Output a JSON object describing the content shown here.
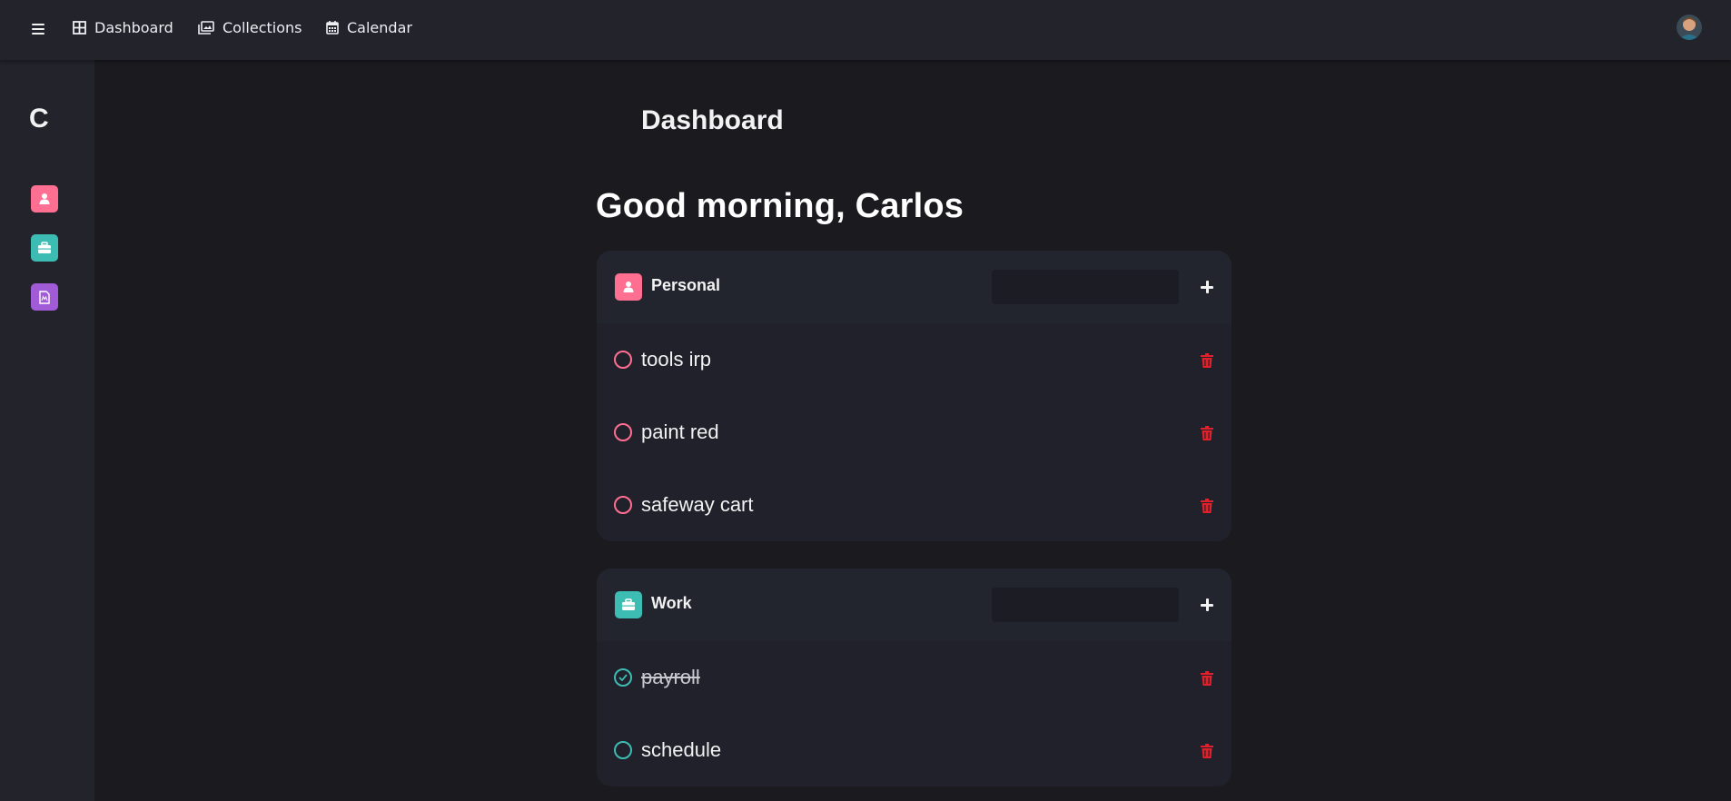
{
  "nav": {
    "items": [
      {
        "label": "Dashboard",
        "icon": "grid-icon"
      },
      {
        "label": "Collections",
        "icon": "images-icon"
      },
      {
        "label": "Calendar",
        "icon": "calendar-icon"
      }
    ]
  },
  "sidebar": {
    "brand": "C",
    "items": [
      {
        "icon": "user-icon",
        "color": "#ff6f91"
      },
      {
        "icon": "briefcase-icon",
        "color": "#3dbcb4"
      },
      {
        "icon": "document-icon",
        "color": "#a15bd6"
      }
    ]
  },
  "main": {
    "page_title": "Dashboard",
    "greeting": "Good morning, Carlos"
  },
  "categories": [
    {
      "title": "Personal",
      "icon": "user-icon",
      "color": "#ff6f91",
      "input_value": "",
      "tasks": [
        {
          "text": "tools irp",
          "done": false
        },
        {
          "text": "paint red",
          "done": false
        },
        {
          "text": "safeway cart",
          "done": false
        }
      ]
    },
    {
      "title": "Work",
      "icon": "briefcase-icon",
      "color": "#3dbcb4",
      "input_value": "",
      "tasks": [
        {
          "text": "payroll",
          "done": true
        },
        {
          "text": "schedule",
          "done": false
        }
      ]
    }
  ],
  "colors": {
    "background": "#1a1a1f",
    "panel": "#22232b",
    "card": "#20212a",
    "delete": "#e0202a"
  }
}
